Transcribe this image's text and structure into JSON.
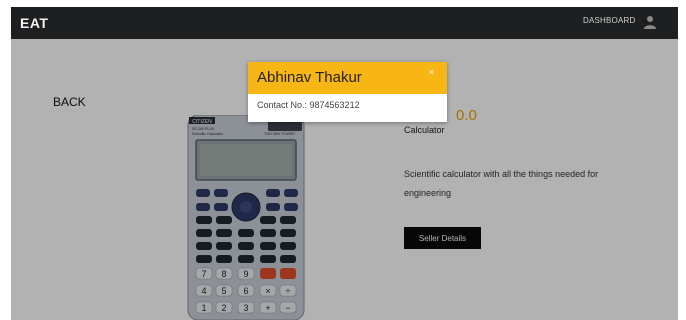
{
  "navbar": {
    "brand": "EAT",
    "dashboard_label": "DASHBOARD",
    "user_icon": "user-icon",
    "background": "#1e1f21"
  },
  "page": {
    "back_label": "BACK",
    "price_fragment": "0.0",
    "product_name": "Calculator",
    "description": "Scientific calculator with all the things needed for engineering",
    "seller_button_label": "Seller Details",
    "image_icon": "calculator-image"
  },
  "calculator": {
    "brand": "CITIZEN",
    "model": "SR-260 PLUS",
    "subtitle": "Scientific Calculator",
    "second_label": "TWO WAY POWER",
    "keys": [
      "7",
      "8",
      "9",
      "4",
      "5",
      "6",
      "×",
      "÷",
      "1",
      "2",
      "3",
      "+",
      "−"
    ]
  },
  "modal": {
    "title": "Abhinav Thakur",
    "contact": "Contact No.: 9874563212",
    "close_label": "×",
    "accent": "#f7b613"
  },
  "colors": {
    "price": "#e9a400",
    "button": "#0c0c0c"
  }
}
